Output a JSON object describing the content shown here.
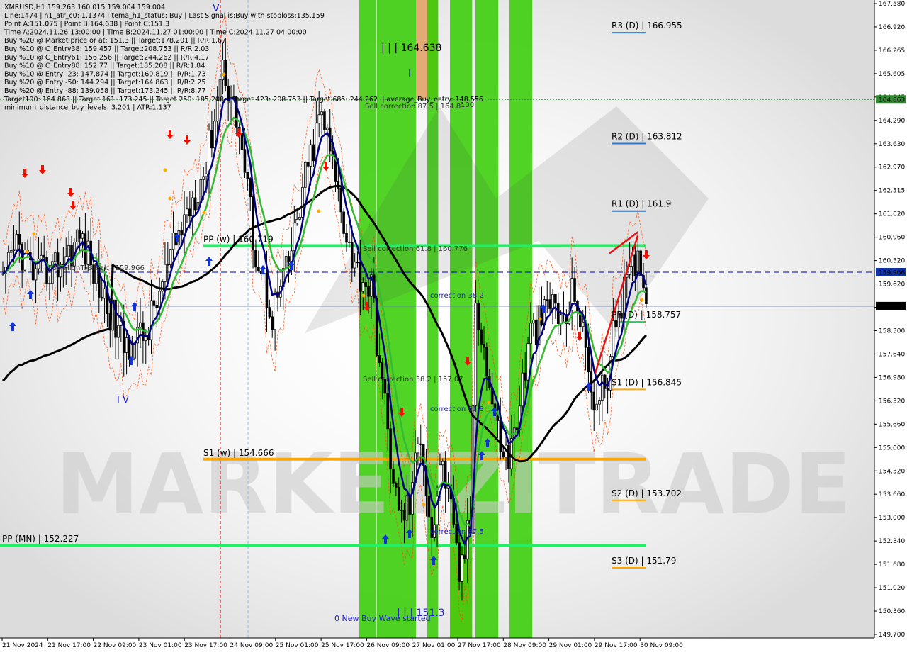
{
  "header": {
    "lines": [
      "XMRUSD,H1  159.263 160.015 159.004 159.004",
      "Line:1474 | h1_atr_c0: 1.1374 | tema_h1_status: Buy | Last Signal is:Buy with stoploss:135.159",
      "Point A:151.075 | Point B:164.638 | Point C:151.3",
      "Time A:2024.11.26 13:00:00 | Time B:2024.11.27 01:00:00 | Time C:2024.11.27 04:00:00",
      "Buy %20 @ Market price or at: 151.3 || Target:178.201 || R/R:1.67",
      "Buy %10 @ C_Entry38: 159.457 || Target:208.753 || R/R:2.03",
      "Buy %10 @ C_Entry61: 156.256 || Target:244.262 || R/R:4.17",
      "Buy %10 @ C_Entry88: 152.77 || Target:185.208 || R/R:1.84",
      "Buy %10 @ Entry -23: 147.874 || Target:169.819 || R/R:1.73",
      "Buy %20 @ Entry -50: 144.294 || Target:164.863 || R/R:2.25",
      "Buy %20 @ Entry -88: 139.058 || Target:173.245 || R/R:8.77",
      "Target100: 164.863 || Target 161: 173.245 || Target 250: 185.208 || Target 423: 208.753 || Target 685: 244.262 || average_Buy_entry: 148.556",
      "minimum_distance_buy_levels: 3.201 | ATR:1.137"
    ]
  },
  "watermark": "MARKETZITRADE",
  "price_axis": {
    "ticks": [
      "167.580",
      "166.920",
      "166.265",
      "165.605",
      "164.945",
      "164.290",
      "163.630",
      "162.970",
      "162.315",
      "161.620",
      "160.960",
      "160.320",
      "159.620",
      "158.960",
      "158.300",
      "157.640",
      "156.980",
      "156.320",
      "155.660",
      "155.000",
      "154.320",
      "153.660",
      "153.000",
      "152.340",
      "151.680",
      "151.020",
      "150.360",
      "149.700"
    ],
    "current_price": "159.004",
    "dashed_level": "159.966",
    "target_level": "164.863"
  },
  "time_axis": {
    "ticks": [
      "21 Nov 2024",
      "21 Nov 17:00",
      "22 Nov 09:00",
      "23 Nov 01:00",
      "23 Nov 17:00",
      "24 Nov 09:00",
      "25 Nov 01:00",
      "25 Nov 17:00",
      "26 Nov 09:00",
      "27 Nov 01:00",
      "27 Nov 17:00",
      "28 Nov 09:00",
      "29 Nov 01:00",
      "29 Nov 17:00",
      "30 Nov 09:00"
    ]
  },
  "levels": {
    "r3": "R3 (D) | 166.955",
    "r2": "R2 (D) | 163.812",
    "r1": "R1 (D) | 161.9",
    "pp_d": "PP (D) | 158.757",
    "s1_d": "S1 (D) | 156.845",
    "s2_d": "S2 (D) | 153.702",
    "s3_d": "S3 (D) | 151.79",
    "pp_w": "PP (w) | 160.719",
    "s1_w": "S1 (w) | 154.666",
    "pp_mn": "PP (MN) | 152.227"
  },
  "annotations": {
    "point_b": "| | | 164.638",
    "point_c": "| | | 151.3",
    "wave_start": "0 New Buy Wave started",
    "sell_corr_87": "Sell correction 87.5 | 164.81",
    "sell_corr_87_tail": "100",
    "sell_corr_61": "Sell correction 61.8 | 160.776",
    "sell_corr_38": "Sell correction 38.2 | 157.07",
    "corr_38": "correction 38.2",
    "corr_61": "correction 61.8",
    "corr_87": "correction 87.5",
    "fsb": "FSB-HighToBreak | 159.966",
    "wave_v": "V",
    "wave_iv": "I V",
    "wave_i": "I"
  },
  "colors": {
    "bull": "#000000",
    "bear": "#000000",
    "green_band": "#33cc00",
    "orange_band": "#e0a060",
    "pp_line": "#22ee66",
    "s1_line": "#ffa500",
    "ema_blue": "#000080",
    "ema_green": "#33bb33",
    "ema_black": "#000000",
    "envelope": "#ff4400"
  },
  "chart_data": {
    "type": "candlestick",
    "symbol": "XMRUSD",
    "timeframe": "H1",
    "ohlc_last": {
      "open": 159.263,
      "high": 160.015,
      "low": 159.004,
      "close": 159.004
    },
    "ylim": [
      149.7,
      167.58
    ],
    "pivot_levels": {
      "R3_D": 166.955,
      "R2_D": 163.812,
      "R1_D": 161.9,
      "PP_D": 158.757,
      "S1_D": 156.845,
      "S2_D": 153.702,
      "S3_D": 151.79,
      "PP_W": 160.719,
      "S1_W": 154.666,
      "PP_MN": 152.227
    },
    "waypoints": [
      {
        "t": 0,
        "p": 159.5
      },
      {
        "t": 5,
        "p": 160.8
      },
      {
        "t": 12,
        "p": 159.8
      },
      {
        "t": 22,
        "p": 160.3
      },
      {
        "t": 28,
        "p": 161.0
      },
      {
        "t": 36,
        "p": 159.4
      },
      {
        "t": 44,
        "p": 157.9
      },
      {
        "t": 52,
        "p": 158.2
      },
      {
        "t": 60,
        "p": 160.1
      },
      {
        "t": 68,
        "p": 161.9
      },
      {
        "t": 74,
        "p": 163.0
      },
      {
        "t": 80,
        "p": 165.9
      },
      {
        "t": 86,
        "p": 164.0
      },
      {
        "t": 92,
        "p": 160.5
      },
      {
        "t": 98,
        "p": 158.8
      },
      {
        "t": 104,
        "p": 160.2
      },
      {
        "t": 110,
        "p": 162.6
      },
      {
        "t": 116,
        "p": 164.5
      },
      {
        "t": 122,
        "p": 162.2
      },
      {
        "t": 128,
        "p": 160.1
      },
      {
        "t": 134,
        "p": 159.5
      },
      {
        "t": 140,
        "p": 155.4
      },
      {
        "t": 144,
        "p": 153.0
      },
      {
        "t": 148,
        "p": 153.4
      },
      {
        "t": 152,
        "p": 155.5
      },
      {
        "t": 156,
        "p": 152.5
      },
      {
        "t": 160,
        "p": 154.7
      },
      {
        "t": 166,
        "p": 151.4
      },
      {
        "t": 170,
        "p": 152.8
      },
      {
        "t": 172,
        "p": 159.4
      },
      {
        "t": 176,
        "p": 157.2
      },
      {
        "t": 180,
        "p": 155.4
      },
      {
        "t": 184,
        "p": 154.6
      },
      {
        "t": 188,
        "p": 156.3
      },
      {
        "t": 192,
        "p": 158.2
      },
      {
        "t": 196,
        "p": 158.6
      },
      {
        "t": 200,
        "p": 159.2
      },
      {
        "t": 204,
        "p": 158.4
      },
      {
        "t": 208,
        "p": 159.6
      },
      {
        "t": 212,
        "p": 157.6
      },
      {
        "t": 216,
        "p": 156.1
      },
      {
        "t": 220,
        "p": 157.1
      },
      {
        "t": 224,
        "p": 159.0
      },
      {
        "t": 228,
        "p": 159.8
      },
      {
        "t": 232,
        "p": 160.4
      },
      {
        "t": 234,
        "p": 159.2
      }
    ]
  }
}
